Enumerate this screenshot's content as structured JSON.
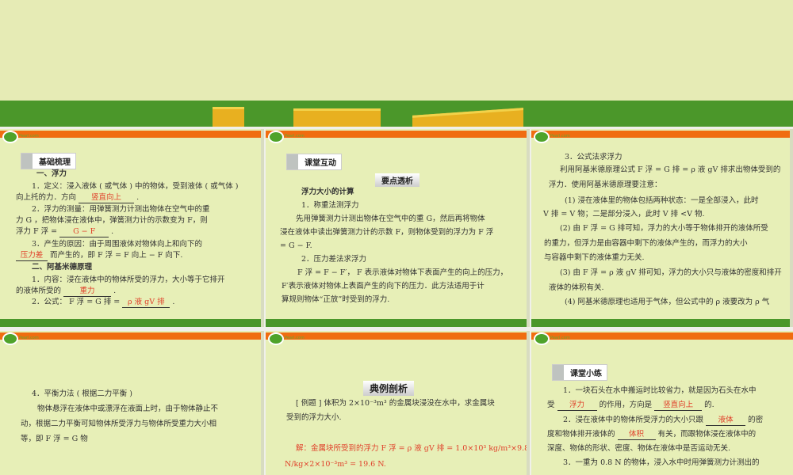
{
  "logo_text": "Pearl.com",
  "s1": {
    "badge": "基础梳理",
    "h1": "一、浮力",
    "l1": "1．定义：浸入液体 ( 或气体 ) 中的物体，受到液体 ( 或气体 )",
    "l2a": "向上托的力．方向",
    "l2b": "竖直向上",
    "l3": "2．浮力的测量：用弹簧测力计测出物体在空气中的重",
    "l4": "力 G ，把物体浸在液体中，弹簧测力计的示数变为 F，则",
    "l5a": "浮力  F 浮 =",
    "l5b": "G − F",
    "l6": "3．产生的原因：由于周围液体对物体向上和向下的",
    "l7a": "压力差",
    "l7b": "而产生的，即  F 浮 = F 向上 − F 向下.",
    "h2": "二、阿基米德原理",
    "l8": "1．内容：浸在液体中的物体所受的浮力，大小等于它排开",
    "l9a": "的液体所受的",
    "l9b": "重力",
    "l10a": "2．公式：  F 浮 = G 排 =",
    "l10b": "ρ 液 gV 排"
  },
  "s2": {
    "badge": "课堂互动",
    "sub": "要点透析",
    "h": "浮力大小的计算",
    "l1": "1．称重法测浮力",
    "l2": "先用弹簧测力计测出物体在空气中的重   G，然后再将物体",
    "l3": "浸在液体中读出弹簧测力计的示数   F，则物体受到的浮力为   F 浮",
    "l4": "= G − F.",
    "l5": "2．压力差法求浮力",
    "l6": "F 浮 = F − F′， F 表示液体对物体下表面产生的向上的压力，",
    "l7": "F′表示液体对物体上表面产生的向下的压力．此方法适用于计",
    "l8": "算规则物体“正放”时受到的浮力."
  },
  "s3": {
    "l1": "3．公式法求浮力",
    "l2": "利用阿基米德原理公式  F 浮 = G 排 = ρ 液 gV 排求出物体受到的",
    "l3": "浮力．使用阿基米德原理要注意：",
    "l4": "(1) 浸在液体里的物体包括两种状态：一是全部浸入，此时",
    "l5": "V 排 = V 物；二是部分浸入，此时  V 排 <V 物.",
    "l6": "(2) 由  F 浮 = G 排可知，浮力的大小等于物体排开的液体所受",
    "l7": "的重力，但浮力是由容器中剩下的液体产生的，而浮力的大小",
    "l8": "与容器中剩下的液体重力无关.",
    "l9": "(3) 由  F 浮 = ρ 液 gV 排可知，浮力的大小只与液体的密度和排开",
    "l10": "液体的体积有关.",
    "l11": "(4) 阿基米德原理也适用于气体，但公式中的 ρ 液要改为 ρ 气"
  },
  "s4": {
    "l1": "4．平衡力法 ( 根据二力平衡 )",
    "l2": "物体悬浮在液体中或漂浮在液面上时，由于物体静止不",
    "l3": "动，根据二力平衡可知物体所受浮力与物体所受重力大小相",
    "l4": "等，即  F 浮 = G 物"
  },
  "s5": {
    "badge": "典例剖析",
    "l1": "[ 例题 ]  体积为  2×10⁻³m³ 的金属块浸没在水中，求金属块",
    "l2": "受到的浮力大小.",
    "l3": "解：金属块所受到的浮力 F 浮 = ρ 液 gV 排 = 1.0×10³ kg/m³×9.8",
    "l4": "N/kg×2×10⁻³m³ = 19.6 N."
  },
  "s6": {
    "badge": "课堂小练",
    "l1": "1．一块石头在水中搬运时比较省力，就是因为石头在水中",
    "l2a": "受",
    "l2b": "浮力",
    "l2c": "的作用，方向是",
    "l2d": "竖直向上",
    "l2e": "的.",
    "l3a": "2．浸在液体中的物体所受浮力的大小只跟",
    "l3b": "液体",
    "l3c": "的密",
    "l4a": "度和物体排开液体的",
    "l4b": "体积",
    "l4c": "有关，而跟物体浸在液体中的",
    "l5": "深度、物体的形状、密度、物体在液体中是否运动无关.",
    "l6": "3．一重为  0.8 N  的物体，浸入水中时用弹簧测力计测出的"
  }
}
